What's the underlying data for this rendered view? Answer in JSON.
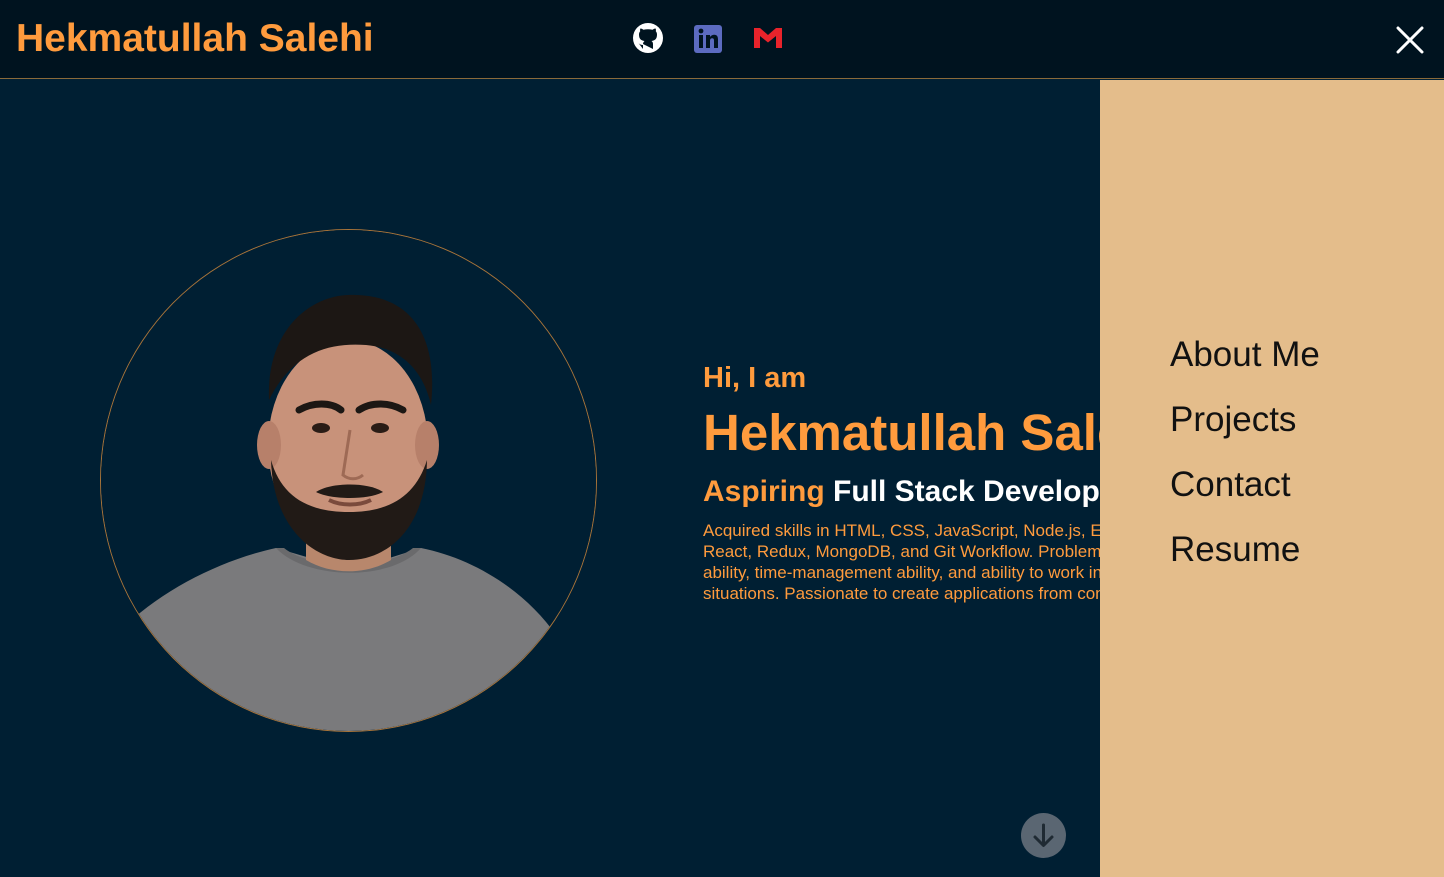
{
  "header": {
    "brand": "Hekmatullah Salehi",
    "socials": [
      {
        "icon": "github-icon",
        "label": "GitHub"
      },
      {
        "icon": "linkedin-icon",
        "label": "LinkedIn",
        "color": "#5c6bc0"
      },
      {
        "icon": "gmail-icon",
        "label": "Gmail",
        "color": "#e8232b"
      }
    ],
    "close_icon": "close-icon"
  },
  "hero": {
    "greeting": "Hi, I am",
    "name": "Hekmatullah Salehi",
    "role_prefix": "Aspiring",
    "role": "Full Stack Developer",
    "bio": "Acquired skills in HTML, CSS, JavaScript, Node.js, Express, React, Redux, MongoDB, and Git Workflow. Problem-solving ability, time-management ability, and ability to work in stressful situations. Passionate to create applications from conception."
  },
  "scroll_icon": "arrow-down-icon",
  "menu": {
    "items": [
      "About Me",
      "Projects",
      "Contact",
      "Resume"
    ]
  },
  "colors": {
    "accent": "#ff9b3d",
    "background": "#001f33",
    "header": "#00131f",
    "drawer": "#e4bd8b"
  }
}
